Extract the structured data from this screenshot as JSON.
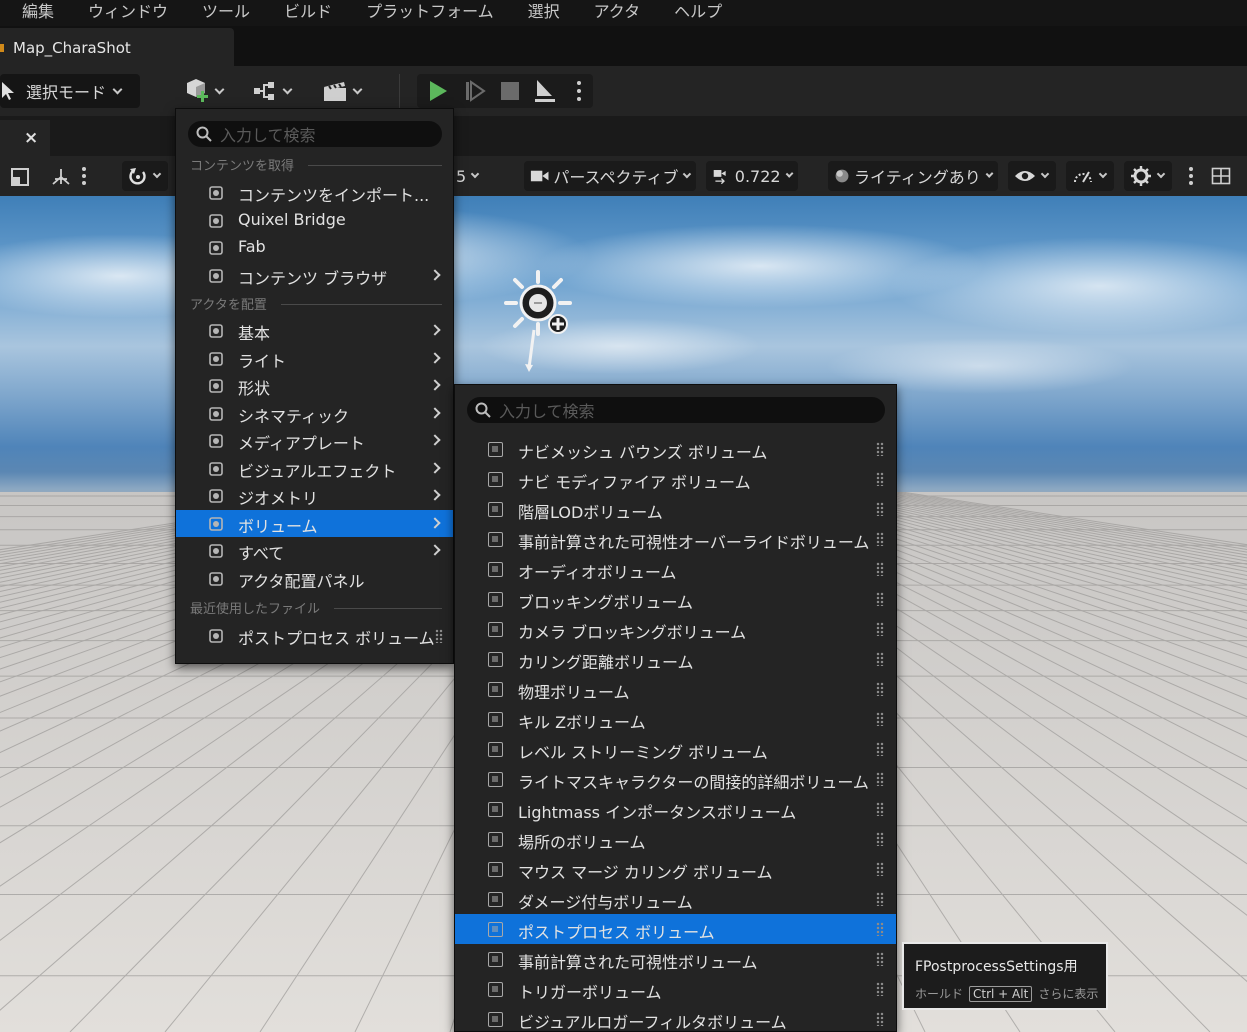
{
  "menubar": {
    "items": [
      "編集",
      "ウィンドウ",
      "ツール",
      "ビルド",
      "プラットフォーム",
      "選択",
      "アクタ",
      "ヘルプ"
    ]
  },
  "map_tab": {
    "label": "Map_CharaShot"
  },
  "toolbar": {
    "mode_select_label": "選択モード",
    "add_icon": "add-actor-cube-icon",
    "blueprint_icon": "blueprint-icon",
    "cinematics_icon": "clapperboard-icon",
    "play_icon": "play-icon",
    "advance_frame_icon": "advance-frame-icon",
    "stop_icon": "stop-icon",
    "eject_icon": "eject-icon",
    "play_color": "#5cb85c"
  },
  "viewport_toolbar": {
    "snap_value_partial": "5",
    "perspective_label": "パースペクティブ",
    "camera_speed": "0.722",
    "lighting_label": "ライティングあり"
  },
  "place_menu": {
    "search_placeholder": "入力して検索",
    "section_get_content": "コンテンツを取得",
    "section_place_actors": "アクタを配置",
    "section_recent": "最近使用したファイル",
    "content_items": [
      {
        "label": "コンテンツをインポート...",
        "icon": "import-icon",
        "submenu": false
      },
      {
        "label": "Quixel Bridge",
        "icon": "bridge-icon",
        "submenu": false
      },
      {
        "label": "Fab",
        "icon": "fab-icon",
        "submenu": false
      },
      {
        "label": "コンテンツ ブラウザ",
        "icon": "content-browser-icon",
        "submenu": true
      }
    ],
    "actor_items": [
      {
        "label": "基本",
        "icon": "basic-icon",
        "submenu": true
      },
      {
        "label": "ライト",
        "icon": "light-bulb-icon",
        "submenu": true
      },
      {
        "label": "形状",
        "icon": "shapes-icon",
        "submenu": true
      },
      {
        "label": "シネマティック",
        "icon": "cinematic-icon",
        "submenu": true
      },
      {
        "label": "メディアプレート",
        "icon": "media-plate-icon",
        "submenu": true
      },
      {
        "label": "ビジュアルエフェクト",
        "icon": "visual-effects-icon",
        "submenu": true
      },
      {
        "label": "ジオメトリ",
        "icon": "geometry-icon",
        "submenu": true
      },
      {
        "label": "ボリューム",
        "icon": "volume-icon",
        "submenu": true,
        "selected": true
      },
      {
        "label": "すべて",
        "icon": "all-classes-icon",
        "submenu": true
      },
      {
        "label": "アクタ配置パネル",
        "icon": "place-actors-panel-icon",
        "submenu": false
      }
    ],
    "recent_items": [
      {
        "label": "ポストプロセス ボリューム",
        "icon": "post-process-volume-icon"
      }
    ]
  },
  "volume_menu": {
    "search_placeholder": "入力して検索",
    "items": [
      "ナビメッシュ バウンズ ボリューム",
      "ナビ モディファイア ボリューム",
      "階層LODボリューム",
      "事前計算された可視性オーバーライドボリューム",
      "オーディオボリューム",
      "ブロッキングボリューム",
      "カメラ ブロッキングボリューム",
      "カリング距離ボリューム",
      "物理ボリューム",
      "キル Zボリューム",
      "レベル ストリーミング ボリューム",
      "ライトマスキャラクターの間接的詳細ボリューム",
      "Lightmass インポータンスボリューム",
      "場所のボリューム",
      "マウス マージ カリング ボリューム",
      "ダメージ付与ボリューム",
      "ポストプロセス ボリューム",
      "事前計算された可視性ボリューム",
      "トリガーボリューム",
      "ビジュアルロガーフィルタボリューム"
    ],
    "selected_index": 16
  },
  "tooltip": {
    "title": "FPostprocessSettings用",
    "hold_label": "ホールド",
    "key_combo": "Ctrl + Alt",
    "more_label": "さらに表示"
  },
  "colors": {
    "selection": "#0f72da",
    "menu_bg": "#242424",
    "toolbar_bg": "#242424"
  }
}
